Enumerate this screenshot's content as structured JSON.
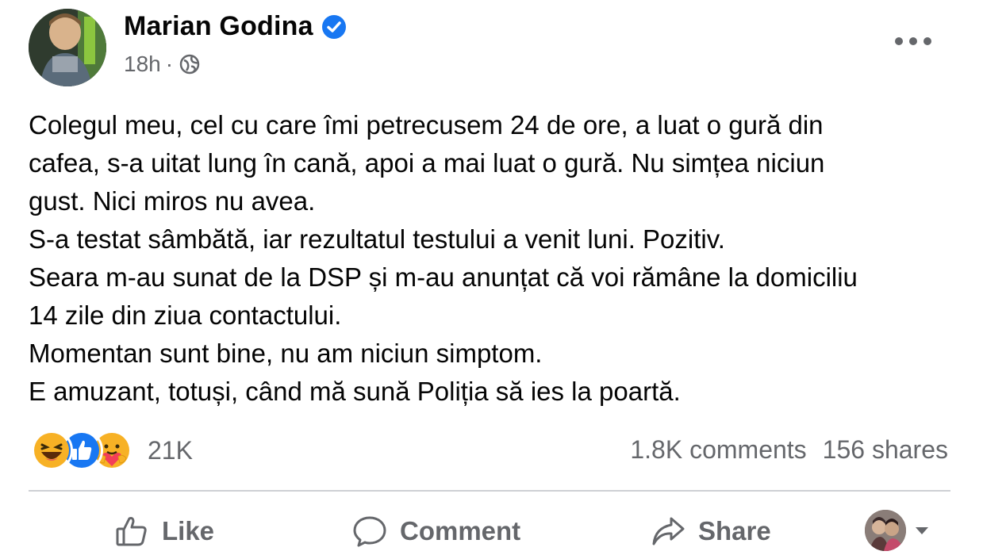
{
  "post": {
    "author": "Marian Godina",
    "verified_icon": "verified-badge-icon",
    "time": "18h",
    "separator": "·",
    "audience_icon": "globe-icon",
    "text_lines": [
      "Colegul meu, cel cu care îmi petrecusem 24 de ore, a luat o gură din",
      "cafea, s-a uitat lung în cană, apoi a mai luat o gură. Nu simțea niciun",
      "gust. Nici miros nu avea.",
      "S-a testat sâmbătă, iar rezultatul testului a venit luni. Pozitiv.",
      "Seara m-au sunat de la DSP și m-au anunțat că voi rămâne la domiciliu",
      "14 zile din ziua contactului.",
      "Momentan sunt bine, nu am niciun simptom.",
      "E amuzant, totuși, când mă sună Poliția să ies la poartă."
    ]
  },
  "engagement": {
    "reactions": [
      "haha-reaction-icon",
      "like-reaction-icon",
      "care-reaction-icon"
    ],
    "reaction_count": "21K",
    "comments": "1.8K comments",
    "shares": "156 shares"
  },
  "actions": {
    "like": "Like",
    "comment": "Comment",
    "share": "Share"
  },
  "colors": {
    "like_blue": "#1877f2",
    "secondary_text": "#65676b",
    "haha_yellow": "#f7b125",
    "divider": "#ced0d4"
  }
}
